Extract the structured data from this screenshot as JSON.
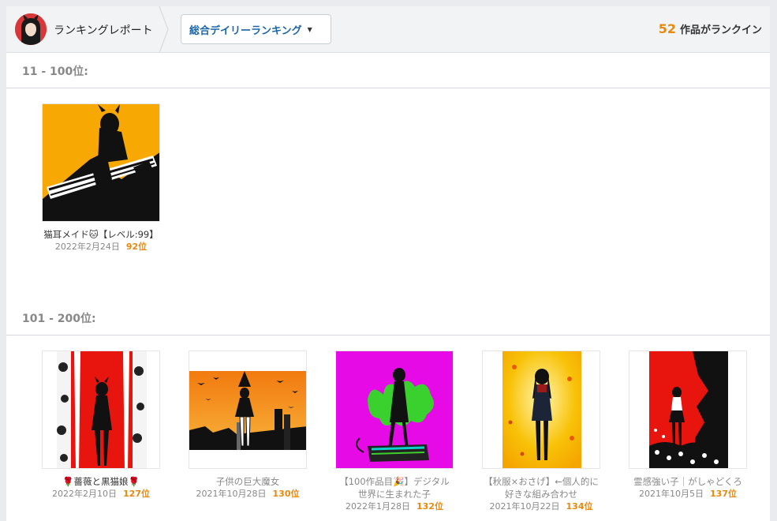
{
  "header": {
    "title": "ランキングレポート",
    "dropdown_label": "総合デイリーランキング",
    "rank_count": "52",
    "rank_count_suffix": "作品がランクイン"
  },
  "sections": [
    {
      "heading": "11 - 100位:",
      "items": [
        {
          "title": "猫耳メイド🐱【レベル:99】",
          "date": "2022年2月24日",
          "rank": "92位"
        }
      ]
    },
    {
      "heading": "101 - 200位:",
      "items": [
        {
          "title": "🌹薔薇と黒猫娘🌹",
          "date": "2022年2月10日",
          "rank": "127位"
        },
        {
          "title": "子供の巨大魔女",
          "date": "2021年10月28日",
          "rank": "130位"
        },
        {
          "title_line1": "【100作品目🎉】デジタル",
          "title_line2": "世界に生まれた子",
          "date": "2022年1月28日",
          "rank": "132位"
        },
        {
          "title_line1": "【秋服×おさげ】←個人的に",
          "title_line2": "好きな組み合わせ",
          "date": "2021年10月22日",
          "rank": "134位"
        },
        {
          "title": "霊感強い子｜がしゃどくろ",
          "date": "2021年10月5日",
          "rank": "137位"
        }
      ]
    }
  ],
  "colors": {
    "accent_orange": "#e8890c",
    "link_blue": "#1a66a8"
  },
  "icons": {
    "dropdown": "caret-down-icon",
    "breadcrumb": "chevron-right-icon"
  }
}
